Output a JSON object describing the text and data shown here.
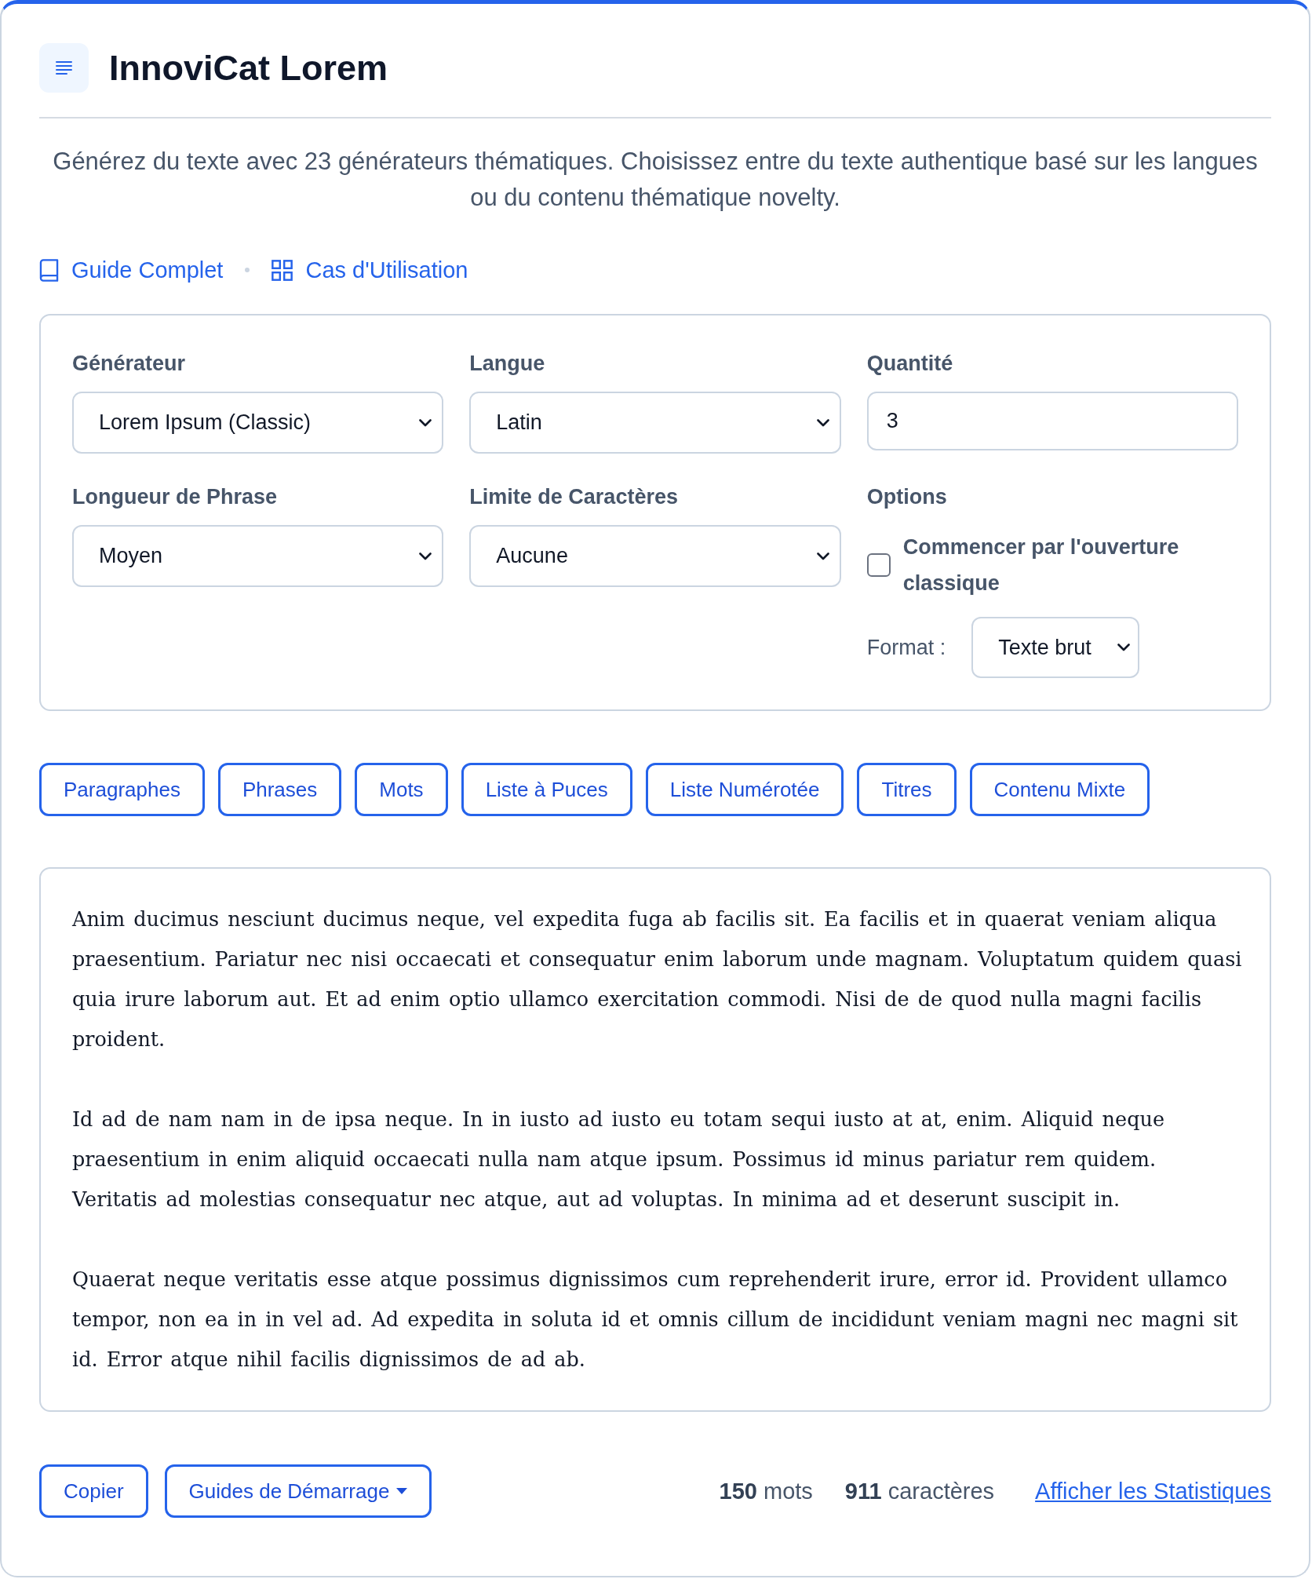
{
  "header": {
    "title": "InnoviCat Lorem"
  },
  "description": "Générez du texte avec 23 générateurs thématiques. Choisissez entre du texte authentique basé sur les langues ou du contenu thématique novelty.",
  "links": [
    {
      "kind": "book",
      "label": "Guide Complet"
    },
    {
      "kind": "grid",
      "label": "Cas d'Utilisation"
    }
  ],
  "settings": {
    "fields": [
      {
        "kind": "select",
        "label": "Générateur",
        "value": "Lorem Ipsum (Classic)"
      },
      {
        "kind": "select",
        "label": "Langue",
        "value": "Latin"
      },
      {
        "kind": "number",
        "label": "Quantité",
        "value": "3"
      },
      {
        "kind": "select",
        "label": "Longueur de Phrase",
        "value": "Moyen"
      },
      {
        "kind": "select",
        "label": "Limite de Caractères",
        "value": "Aucune"
      },
      {
        "kind": "options",
        "label": "Options",
        "checkbox": {
          "label": "Commencer par l'ouverture classique",
          "checked": false
        },
        "format": {
          "label": "Format :",
          "value": "Texte brut"
        }
      }
    ]
  },
  "format_buttons": [
    "Paragraphes",
    "Phrases",
    "Mots",
    "Liste à Puces",
    "Liste Numérotée",
    "Titres",
    "Contenu Mixte"
  ],
  "output": {
    "paragraphs": [
      "Anim ducimus nesciunt ducimus neque, vel expedita fuga ab facilis sit. Ea facilis et in quaerat veniam aliqua praesentium. Pariatur nec nisi occaecati et consequatur enim laborum unde magnam. Voluptatum quidem quasi quia irure laborum aut. Et ad enim optio ullamco exercitation commodi. Nisi de de quod nulla magni facilis proident.",
      "Id ad de nam nam in de ipsa neque. In in iusto ad iusto eu totam sequi iusto at at, enim. Aliquid neque praesentium in enim aliquid occaecati nulla nam atque ipsum. Possimus id minus pariatur rem quidem. Veritatis ad molestias consequatur nec atque, aut ad voluptas. In minima ad et deserunt suscipit in.",
      "Quaerat neque veritatis esse atque possimus dignissimos cum reprehenderit irure, error id. Provident ullamco tempor, non ea in in vel ad. Ad expedita in soluta id et omnis cillum de incididunt veniam magni nec magni sit id. Error atque nihil facilis dignissimos de ad ab."
    ]
  },
  "footer": {
    "buttons": [
      {
        "kind": "plain",
        "label": "Copier"
      },
      {
        "kind": "dropdown",
        "label": "Guides de Démarrage"
      }
    ],
    "stats": [
      "**150** mots",
      "**911** caractères"
    ],
    "link": "Afficher les Statistiques"
  }
}
